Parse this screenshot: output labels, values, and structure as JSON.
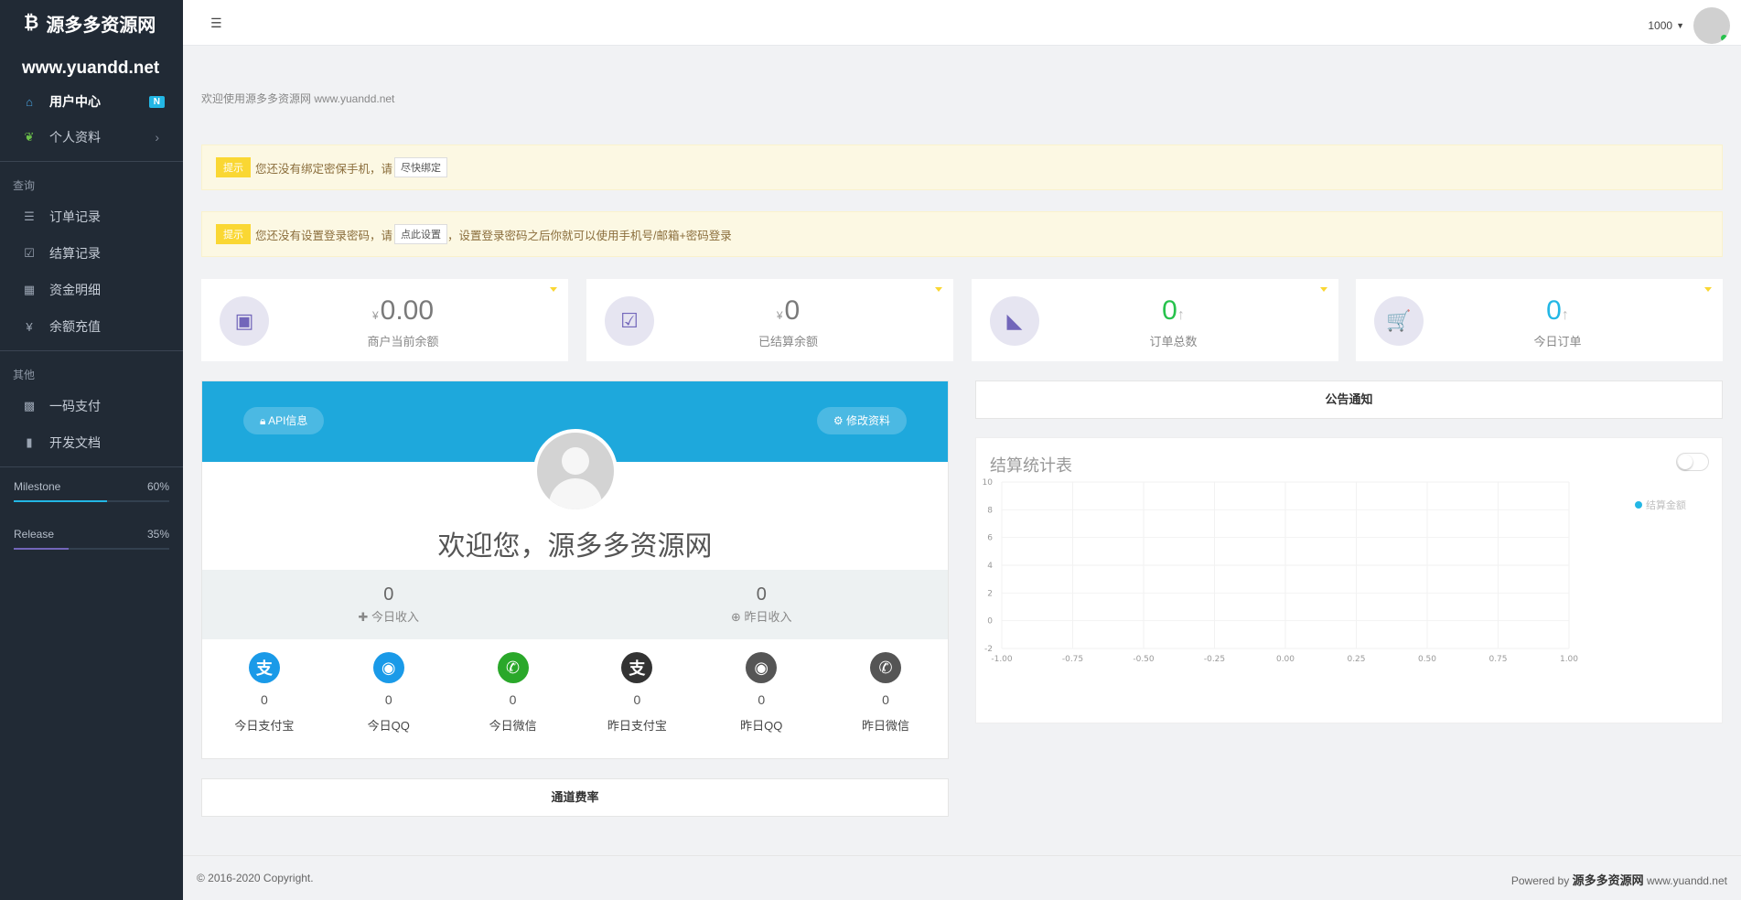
{
  "sidebar": {
    "brand": "源多多资源网",
    "site_url": "www.yuandd.net",
    "items": [
      {
        "label": "用户中心",
        "badge": "N"
      },
      {
        "label": "个人资料"
      }
    ],
    "section_query": "查询",
    "query_items": [
      {
        "label": "订单记录"
      },
      {
        "label": "结算记录"
      },
      {
        "label": "资金明细"
      },
      {
        "label": "余额充值"
      }
    ],
    "section_other": "其他",
    "other_items": [
      {
        "label": "一码支付"
      },
      {
        "label": "开发文档"
      }
    ],
    "progress": [
      {
        "label": "Milestone",
        "value_text": "60%",
        "value": 0.6,
        "color": "#23b7e5"
      },
      {
        "label": "Release",
        "value_text": "35%",
        "value": 0.35,
        "color": "#7266ba"
      }
    ]
  },
  "header": {
    "user_id": "1000"
  },
  "welcome_line": "欢迎使用源多多资源网 www.yuandd.net",
  "alerts": [
    {
      "tag": "提示",
      "text_before": "您还没有绑定密保手机，请",
      "button": "尽快绑定",
      "text_after": ""
    },
    {
      "tag": "提示",
      "text_before": "您还没有设置登录密码，请",
      "button": "点此设置",
      "text_after": "，设置登录密码之后你就可以使用手机号/邮箱+密码登录"
    }
  ],
  "stats": [
    {
      "currency": "¥",
      "value": "0.00",
      "label": "商户当前余额"
    },
    {
      "currency": "¥",
      "value": "0",
      "label": "已结算余额"
    },
    {
      "value": "0",
      "arrow": "↑",
      "label": "订单总数",
      "color": "#27c24c"
    },
    {
      "value": "0",
      "arrow": "↑",
      "label": "今日订单",
      "color": "#23b7e5"
    }
  ],
  "profile": {
    "api_button": "API信息",
    "edit_button": "修改资料",
    "welcome": "欢迎您，源多多资源网",
    "today_income": {
      "value": "0",
      "label": "今日收入"
    },
    "yesterday_income": {
      "value": "0",
      "label": "昨日收入"
    },
    "payments": [
      {
        "value": "0",
        "label": "今日支付宝",
        "icon": "alipay-icon",
        "color": "#1a9ae8"
      },
      {
        "value": "0",
        "label": "今日QQ",
        "icon": "qq-icon",
        "color": "#1a9ae8"
      },
      {
        "value": "0",
        "label": "今日微信",
        "icon": "wechat-icon",
        "color": "#2aa82a"
      },
      {
        "value": "0",
        "label": "昨日支付宝",
        "icon": "alipay-icon",
        "color": "#333333"
      },
      {
        "value": "0",
        "label": "昨日QQ",
        "icon": "qq-icon",
        "color": "#555555"
      },
      {
        "value": "0",
        "label": "昨日微信",
        "icon": "wechat-icon",
        "color": "#555555"
      }
    ]
  },
  "rate_panel": "通道费率",
  "notice_panel": "公告通知",
  "chart_data": {
    "type": "line",
    "title": "结算统计表",
    "series": [
      {
        "name": "结算金额",
        "values": [],
        "color": "#23b7e5"
      }
    ],
    "xlim": [
      -1.0,
      1.0
    ],
    "ylim": [
      -2,
      10
    ],
    "x_ticks": [
      "-1.00",
      "-0.75",
      "-0.50",
      "-0.25",
      "0.00",
      "0.25",
      "0.50",
      "0.75",
      "1.00"
    ],
    "y_ticks": [
      "10",
      "8",
      "6",
      "4",
      "2",
      "0",
      "-2"
    ],
    "grid": true,
    "legend": "top-right"
  },
  "footer": {
    "copyright": "© 2016-2020 Copyright.",
    "powered_prefix": "Powered by",
    "powered_name": "源多多资源网",
    "powered_url": "www.yuandd.net"
  }
}
